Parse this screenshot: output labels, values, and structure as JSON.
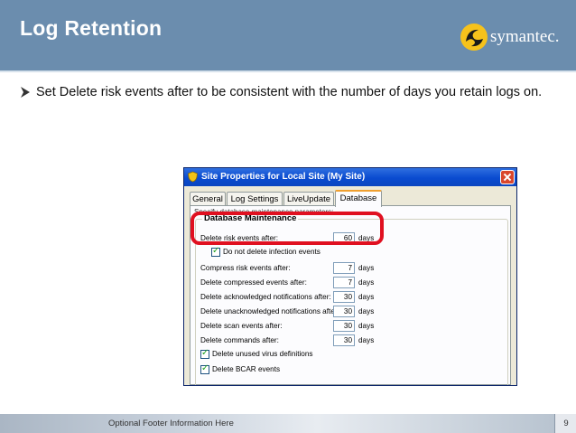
{
  "slide": {
    "title": "Log Retention",
    "brand": "symantec.",
    "bullet": "Set Delete risk events after to be consistent with the number of days you retain logs on.",
    "footer": "Optional Footer Information Here",
    "page_number": "9"
  },
  "dialog": {
    "title": "Site Properties for Local Site (My Site)",
    "tabs": [
      "General",
      "Log Settings",
      "LiveUpdate",
      "Database"
    ],
    "active_tab": "Database",
    "hint": "Specify database maintenance parameters:",
    "group_label": "Database Maintenance",
    "rows": [
      {
        "label": "Delete risk events after:",
        "value": "60",
        "unit": "days"
      },
      {
        "label": "Compress risk events after:",
        "value": "7",
        "unit": "days"
      },
      {
        "label": "Delete compressed events after:",
        "value": "7",
        "unit": "days"
      },
      {
        "label": "Delete acknowledged notifications after:",
        "value": "30",
        "unit": "days"
      },
      {
        "label": "Delete unacknowledged notifications after:",
        "value": "30",
        "unit": "days"
      },
      {
        "label": "Delete scan events after:",
        "value": "30",
        "unit": "days"
      },
      {
        "label": "Delete commands after:",
        "value": "30",
        "unit": "days"
      }
    ],
    "checkboxes": [
      {
        "label": "Do not delete infection events",
        "checked": true
      },
      {
        "label": "Delete unused virus definitions",
        "checked": true
      },
      {
        "label": "Delete BCAR events",
        "checked": true
      }
    ]
  },
  "colors": {
    "header": "#6b8dae",
    "highlight": "#e01020",
    "titlebar": "#0a4bd0"
  }
}
